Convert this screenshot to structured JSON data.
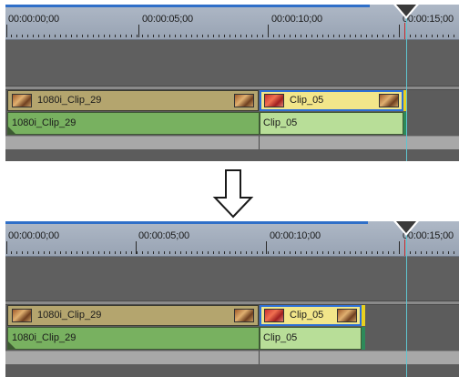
{
  "timelines": {
    "before": {
      "ruler": [
        "00:00:00;00",
        "00:00:05;00",
        "00:00:10;00",
        "00:00:15;00"
      ],
      "video_clips": [
        {
          "label": "1080i_Clip_29",
          "selected": false
        },
        {
          "label": "Clip_05",
          "selected": true
        }
      ],
      "audio_clips": [
        {
          "label": "1080i_Clip_29"
        },
        {
          "label": "Clip_05"
        }
      ]
    },
    "after": {
      "ruler": [
        "00:00:00;00",
        "00:00:05;00",
        "00:00:10;00",
        "00:00:15;00"
      ],
      "video_clips": [
        {
          "label": "1080i_Clip_29",
          "selected": false
        },
        {
          "label": "Clip_05",
          "selected": true
        }
      ],
      "audio_clips": [
        {
          "label": "1080i_Clip_29"
        },
        {
          "label": "Clip_05"
        }
      ]
    }
  },
  "arrow_icon": "down-arrow-icon",
  "colors": {
    "video_clip": "#b4a56e",
    "video_clip_selected": "#f2e68a",
    "audio_clip": "#78b160",
    "audio_clip_light": "#b8de98",
    "selection_border": "#2d6fd6",
    "cursor": "#5fc5d0",
    "ruler": "#a6b0be"
  }
}
